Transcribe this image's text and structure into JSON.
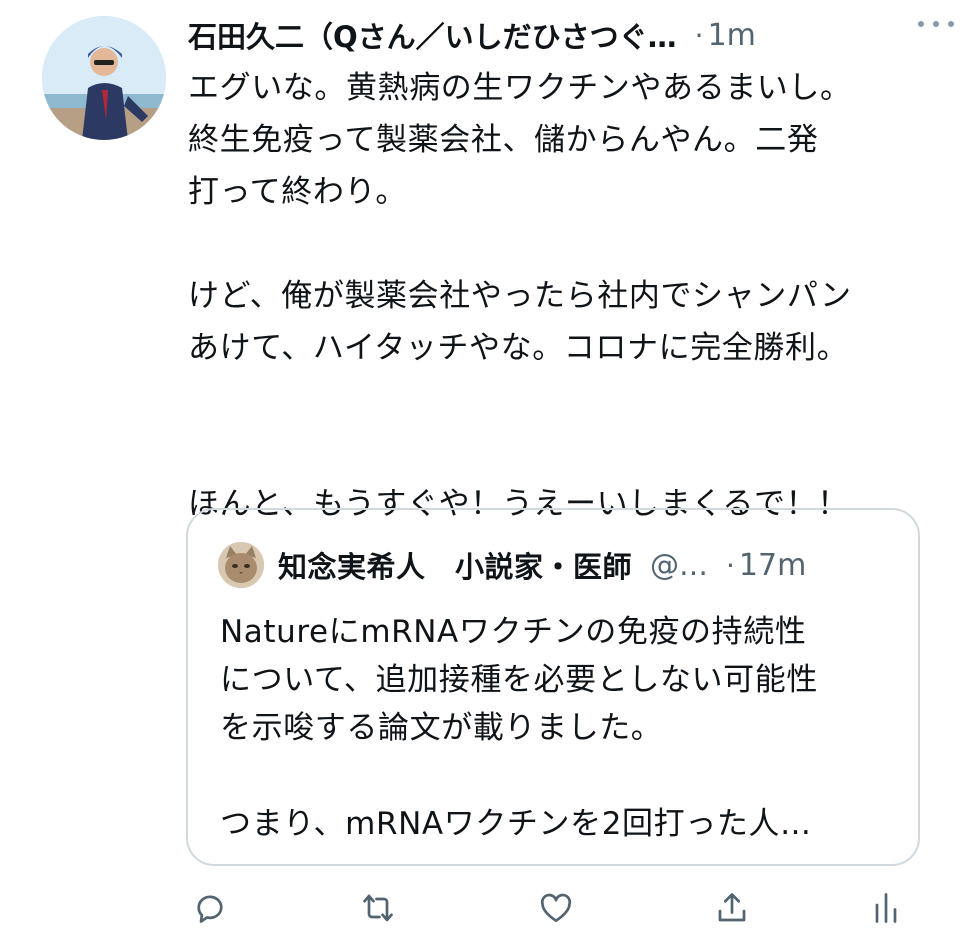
{
  "tweet": {
    "author_name": "石田久二（Qさん／いしだひさつぐ…",
    "separator": "·",
    "time": "1m",
    "more_icon": "more-horizontal-icon",
    "text_lines": [
      "エグいな。黄熱病の生ワクチンやあるまいし。",
      "終生免疫って製薬会社、儲からんやん。二発",
      "打って終わり。",
      "",
      "けど、俺が製薬会社やったら社内でシャンパン",
      "あけて、ハイタッチやな。コロナに完全勝利。",
      "",
      "",
      "ほんと、もうすぐや！うえーいしまくるで！！"
    ]
  },
  "quoted_tweet": {
    "author_name": "知念実希人　小説家・医師",
    "handle": "@…",
    "separator": "·",
    "time": "17m",
    "text_lines": [
      "NatureにmRNAワクチンの免疫の持続性",
      "について、追加接種を必要としない可能性",
      "を示唆する論文が載りました。",
      "",
      "つまり、mRNAワクチンを2回打った人…"
    ]
  },
  "actions": {
    "reply_icon": "reply-icon",
    "retweet_icon": "retweet-icon",
    "like_icon": "like-heart-icon",
    "share_icon": "share-icon",
    "analytics_icon": "analytics-icon"
  },
  "colors": {
    "text_primary": "#0f1419",
    "text_secondary": "#536471",
    "border": "#cfd9de",
    "icon": "#536471"
  }
}
